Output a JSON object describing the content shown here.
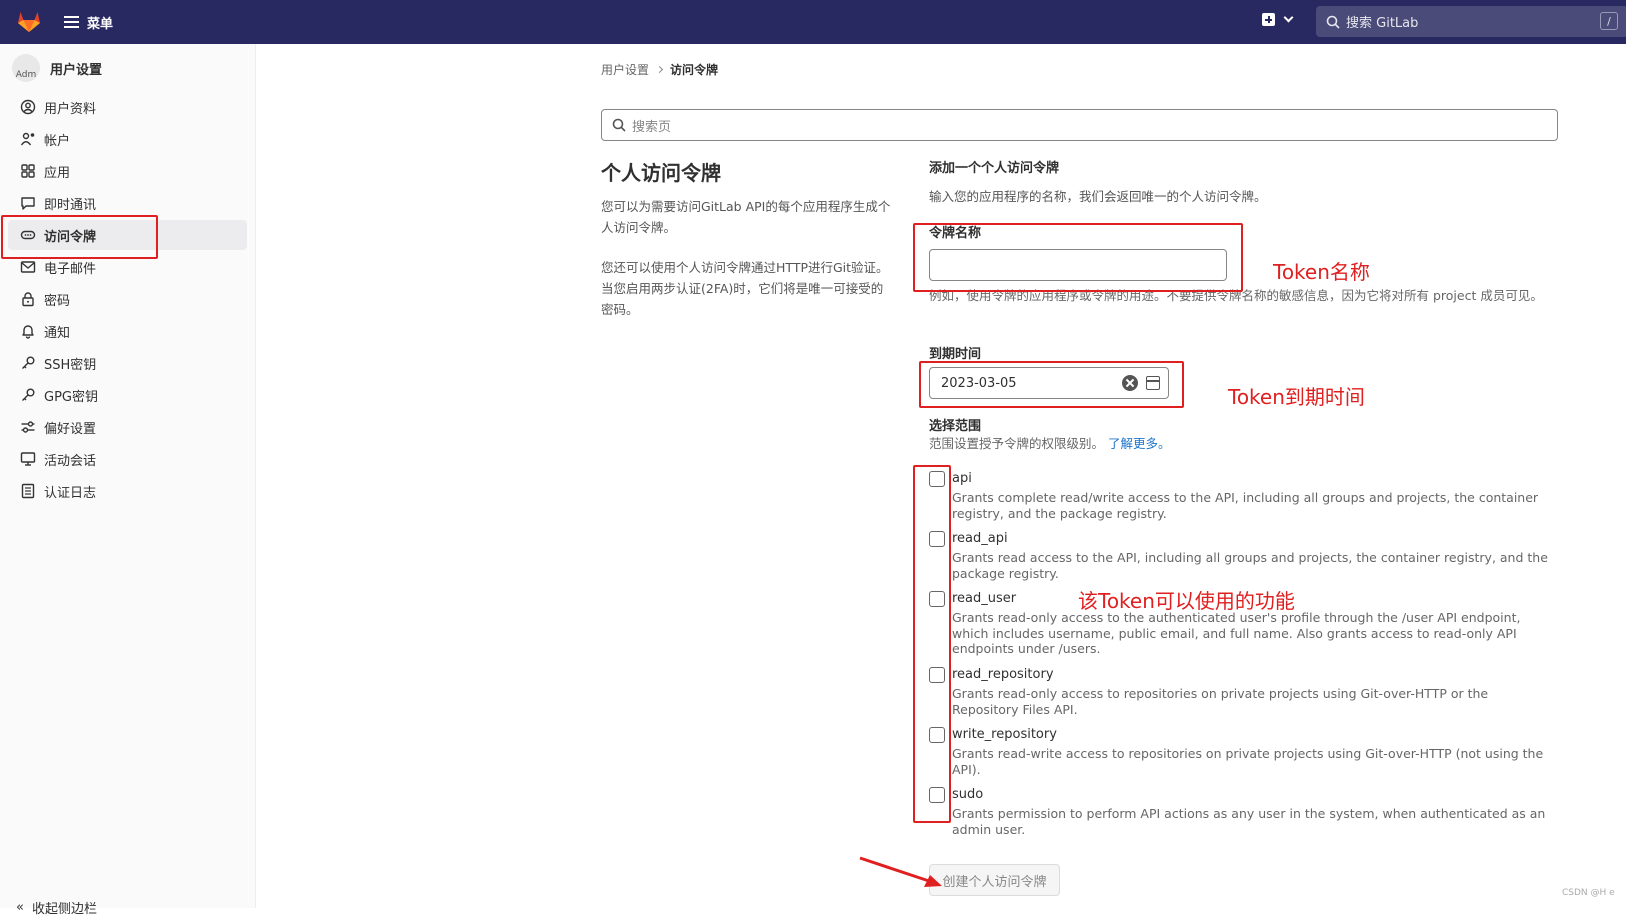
{
  "topbar": {
    "menu_label": "菜单",
    "search_placeholder": "搜索 GitLab",
    "search_shortcut": "/"
  },
  "sidebar": {
    "avatar_text": "Adm",
    "title": "用户设置",
    "items": [
      {
        "label": "用户资料",
        "icon": "profile-icon"
      },
      {
        "label": "帐户",
        "icon": "account-icon"
      },
      {
        "label": "应用",
        "icon": "applications-icon"
      },
      {
        "label": "即时通讯",
        "icon": "chat-icon"
      },
      {
        "label": "访问令牌",
        "icon": "token-icon",
        "active": true
      },
      {
        "label": "电子邮件",
        "icon": "mail-icon"
      },
      {
        "label": "密码",
        "icon": "lock-icon"
      },
      {
        "label": "通知",
        "icon": "bell-icon"
      },
      {
        "label": "SSH密钥",
        "icon": "key-icon"
      },
      {
        "label": "GPG密钥",
        "icon": "key-icon"
      },
      {
        "label": "偏好设置",
        "icon": "preferences-icon"
      },
      {
        "label": "活动会话",
        "icon": "monitor-icon"
      },
      {
        "label": "认证日志",
        "icon": "log-icon"
      }
    ],
    "collapse_label": "收起侧边栏"
  },
  "breadcrumb": {
    "parent": "用户设置",
    "current": "访问令牌"
  },
  "page_search": {
    "placeholder": "搜索页"
  },
  "intro": {
    "title": "个人访问令牌",
    "para1": "您可以为需要访问GitLab API的每个应用程序生成个人访问令牌。",
    "para2": "您还可以使用个人访问令牌通过HTTP进行Git验证。 当您启用两步认证(2FA)时，它们将是唯一可接受的密码。"
  },
  "form": {
    "section_title": "添加一个个人访问令牌",
    "section_desc": "输入您的应用程序的名称，我们会返回唯一的个人访问令牌。",
    "name_label": "令牌名称",
    "name_value": "",
    "name_help": "例如，使用令牌的应用程序或令牌的用途。不要提供令牌名称的敏感信息，因为它将对所有 project 成员可见。",
    "expiry_label": "到期时间",
    "expiry_value": "2023-03-05",
    "scopes_title": "选择范围",
    "scopes_desc": "范围设置授予令牌的权限级别。",
    "scopes_link": "了解更多。",
    "scopes": [
      {
        "name": "api",
        "desc": "Grants complete read/write access to the API, including all groups and projects, the container registry, and the package registry."
      },
      {
        "name": "read_api",
        "desc": "Grants read access to the API, including all groups and projects, the container registry, and the package registry."
      },
      {
        "name": "read_user",
        "desc": "Grants read-only access to the authenticated user's profile through the /user API endpoint, which includes username, public email, and full name. Also grants access to read-only API endpoints under /users."
      },
      {
        "name": "read_repository",
        "desc": "Grants read-only access to repositories on private projects using Git-over-HTTP or the Repository Files API."
      },
      {
        "name": "write_repository",
        "desc": "Grants read-write access to repositories on private projects using Git-over-HTTP (not using the API)."
      },
      {
        "name": "sudo",
        "desc": "Grants permission to perform API actions as any user in the system, when authenticated as an admin user."
      }
    ],
    "submit_label": "创建个人访问令牌"
  },
  "annotations": {
    "token_name": "Token名称",
    "token_expiry": "Token到期时间",
    "token_scopes": "该Token可以使用的功能"
  },
  "watermark": "CSDN @H e"
}
